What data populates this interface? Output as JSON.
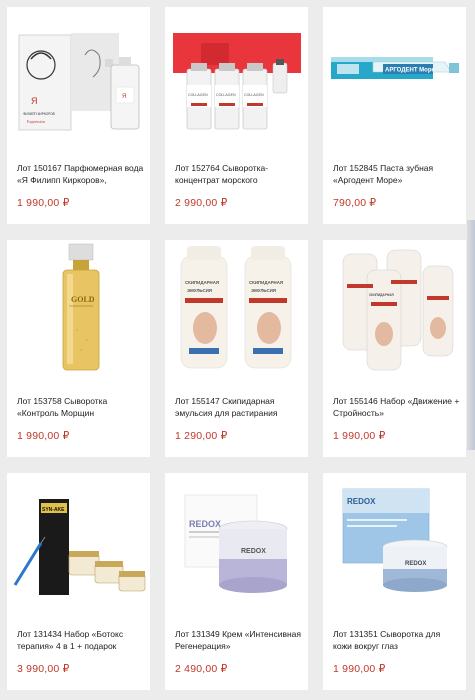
{
  "colors": {
    "price": "#c0392b",
    "background": "#ececec",
    "card": "#ffffff"
  },
  "products": [
    {
      "title": "Лот 150167 Парфюмерная вода «Я Филипп Киркоров»,",
      "price": "1 990,00 ₽",
      "image": "perfume-bottle-image",
      "label": {
        "brand": "Я",
        "name": "ФИЛИПП КИРКОРОВ",
        "line": "Expression"
      }
    },
    {
      "title": "Лот 152764 Сыворотка-концентрат морского",
      "price": "2 990,00 ₽",
      "image": "serum-vials-image",
      "label": {
        "brand": "COLLAGEN"
      }
    },
    {
      "title": "Лот 152845 Паста зубная «Аргодент Море»",
      "price": "790,00 ₽",
      "image": "toothpaste-image",
      "label": {
        "brand": "АРГОДЕНТ Море"
      }
    },
    {
      "title": "Лот 153758 Сыворотка «Контроль Морщин",
      "price": "1 990,00 ₽",
      "image": "gold-spray-image",
      "label": {
        "brand": "GOLD"
      }
    },
    {
      "title": "Лот 155147 Скипидарная эмульсия для растирания",
      "price": "1 290,00 ₽",
      "image": "emulsion-bottles-image",
      "label": {
        "brand": "СКИПИДАРНАЯ ЭМУЛЬСИЯ"
      }
    },
    {
      "title": "Лот 155146 Набор «Движение + Стройность»",
      "price": "1 990,00 ₽",
      "image": "bottle-set-image",
      "label": {
        "brand": "СКИПИДАРНАЯ ЭМУЛЬСИЯ"
      }
    },
    {
      "title": "Лот 131434 Набор «Ботокс терапия» 4 в 1 + подарок",
      "price": "3 990,00 ₽",
      "image": "botox-set-image",
      "label": {
        "brand": "SYN-AKE"
      }
    },
    {
      "title": "Лот 131349 Крем «Интенсивная Регенерация»",
      "price": "2 490,00 ₽",
      "image": "cream-jar-image",
      "label": {
        "brand": "REDOX"
      }
    },
    {
      "title": "Лот 131351 Сыворотка для кожи вокруг глаз",
      "price": "1 990,00 ₽",
      "image": "eye-serum-image",
      "label": {
        "brand": "REDOX"
      }
    }
  ]
}
